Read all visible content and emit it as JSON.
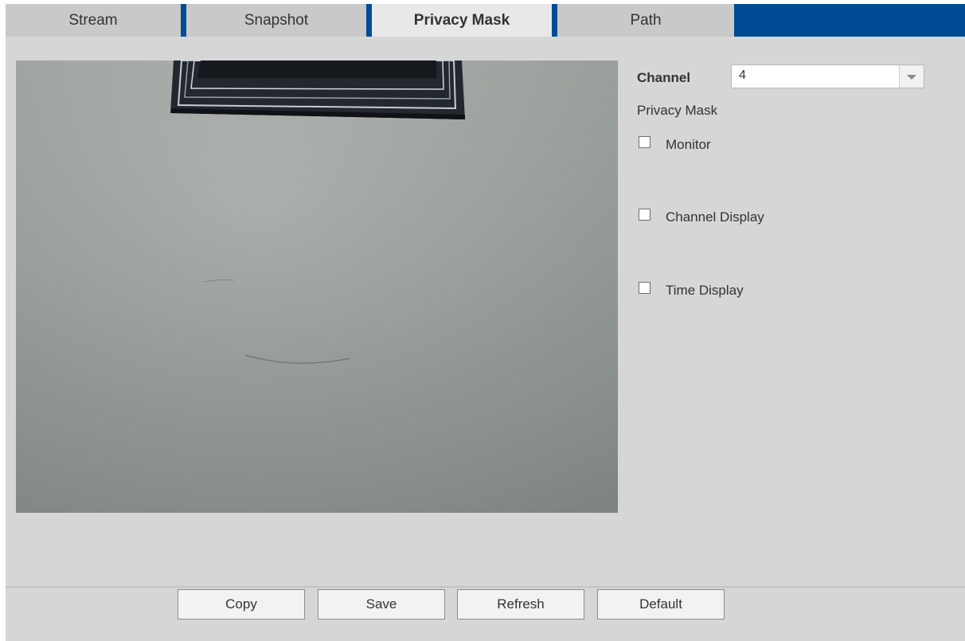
{
  "tabs": {
    "stream": "Stream",
    "snapshot": "Snapshot",
    "privacy_mask": "Privacy Mask",
    "path": "Path",
    "active": "Privacy Mask"
  },
  "panel": {
    "channel_label": "Channel",
    "channel_value": "4",
    "privacy_mask_label": "Privacy Mask",
    "monitor_label": "Monitor",
    "channel_display_label": "Channel Display",
    "time_display_label": "Time Display",
    "monitor_checked": false,
    "channel_display_checked": false,
    "time_display_checked": false
  },
  "buttons": {
    "copy": "Copy",
    "save": "Save",
    "refresh": "Refresh",
    "default": "Default"
  },
  "colors": {
    "tabbar_accent": "#004b93",
    "page_background": "#d6d6d6"
  },
  "icons": {
    "select_arrow": "chevron-down-icon"
  }
}
